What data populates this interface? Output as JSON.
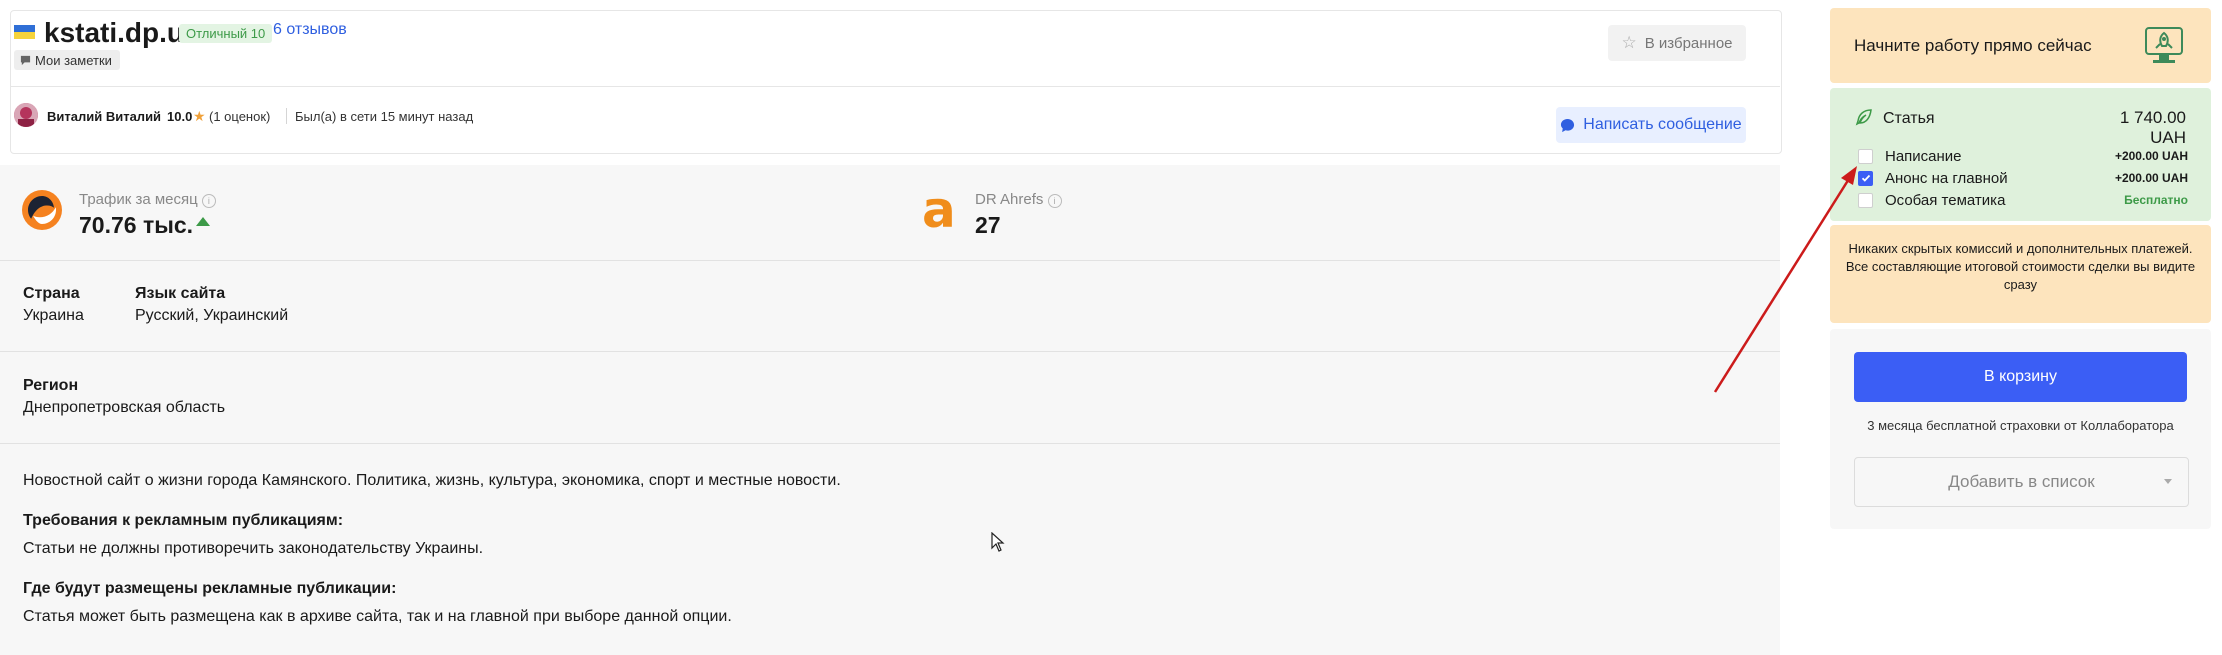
{
  "header": {
    "site_name": "kstati.dp.ua",
    "rating_badge": "Отличный 10",
    "reviews_link": "6 отзывов",
    "notes_tag": "Мои заметки",
    "favorite_button": "В избранное"
  },
  "owner": {
    "name": "Виталий Виталий",
    "score": "10.0",
    "rating_count": "(1 оценок)",
    "status": "Был(а) в сети 15 минут назад",
    "message_button": "Написать сообщение"
  },
  "metrics": {
    "traffic_label": "Трафик за месяц",
    "traffic_value": "70.76 тыс.",
    "dr_label": "DR Ahrefs",
    "dr_value": "27"
  },
  "details": {
    "country_label": "Страна",
    "country_value": "Украина",
    "language_label": "Язык сайта",
    "language_value": "Русский, Украинский",
    "region_label": "Регион",
    "region_value": "Днепропетровская область",
    "description": "Новостной сайт о жизни города Камянского. Политика, жизнь, культура, экономика, спорт и местные новости.",
    "requirements_label": "Требования к рекламным публикациям:",
    "requirements_value": "Статьи не должны противоречить законодательству Украины.",
    "placement_label": "Где будут размещены рекламные публикации:",
    "placement_value": "Статья может быть размещена как в архиве сайта, так и на главной при выборе данной опции."
  },
  "sidebar": {
    "promo_text": "Начните работу прямо сейчас",
    "article_label": "Статья",
    "article_price": "1 740.00 UAH",
    "options": [
      {
        "label": "Написание",
        "price": "+200.00 UAH",
        "checked": false
      },
      {
        "label": "Анонс на главной",
        "price": "+200.00 UAH",
        "checked": true
      },
      {
        "label": "Особая тематика",
        "price": "Бесплатно",
        "checked": false
      }
    ],
    "notice": "Никаких скрытых комиссий и дополнительных платежей. Все составляющие итоговой стоимости сделки вы видите сразу",
    "cart_button": "В корзину",
    "insurance_text": "3 месяца бесплатной страховки от Коллаборатора",
    "add_to_list_button": "Добавить в список"
  },
  "colors": {
    "primary": "#3b5ef5",
    "link": "#2f5fe0",
    "success": "#3d9a48",
    "promo_bg": "#fde4bd",
    "price_bg": "#dff1dc",
    "annotation_arrow": "#cc1b1b",
    "ahrefs_orange": "#f08d1b"
  }
}
